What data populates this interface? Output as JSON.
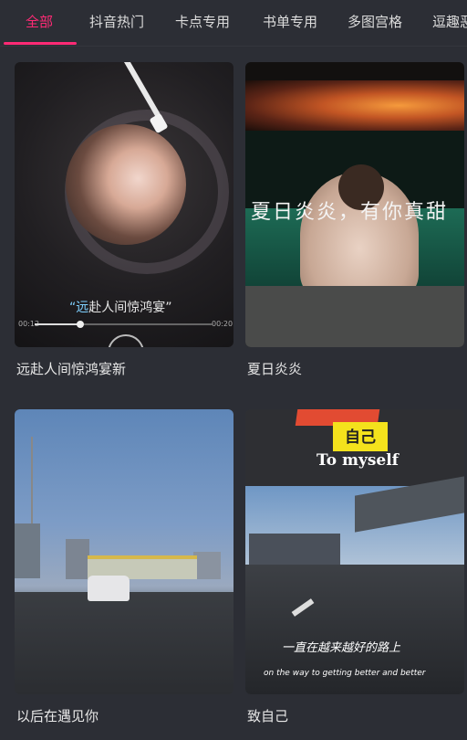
{
  "tabs": [
    {
      "label": "全部",
      "active": true
    },
    {
      "label": "抖音热门",
      "active": false
    },
    {
      "label": "卡点专用",
      "active": false
    },
    {
      "label": "书单专用",
      "active": false
    },
    {
      "label": "多图宫格",
      "active": false
    },
    {
      "label": "逗趣恶",
      "active": false
    }
  ],
  "colors": {
    "accent": "#ff2a75",
    "background": "#2c2e35"
  },
  "templates": [
    {
      "caption": "远赴人间惊鸿宴新",
      "overlay_quote_highlight": "“远",
      "overlay_quote_rest": "赴人间惊鸿宴”",
      "time_start": "00:12",
      "time_end": "00:20"
    },
    {
      "caption": "夏日炎炎",
      "overlay_title": "夏日炎炎，有你真甜"
    },
    {
      "caption": "以后在遇见你"
    },
    {
      "caption": "致自己",
      "overlay_badge": "自己",
      "overlay_title": "To myself",
      "overlay_line": "一直在越来越好的路上",
      "overlay_subline": "on the way to getting better and better"
    }
  ]
}
